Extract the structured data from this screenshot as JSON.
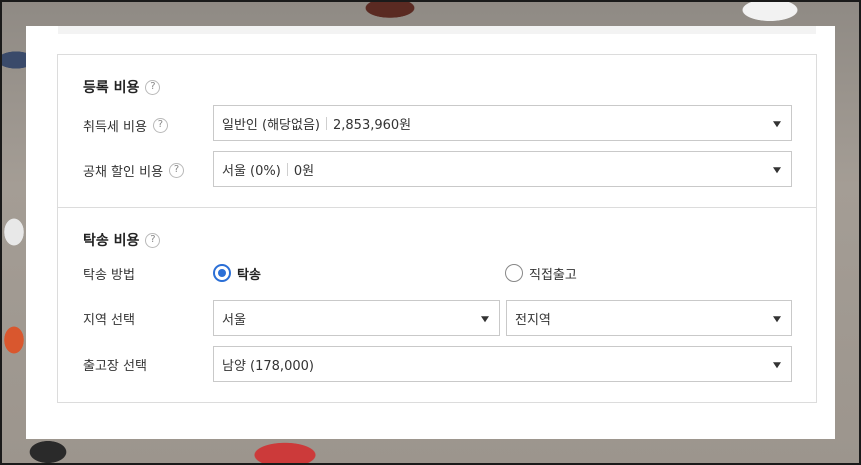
{
  "registration": {
    "title": "등록 비용",
    "help": "?",
    "acquisition_tax": {
      "label": "취득세 비용",
      "help": "?",
      "selected_type": "일반인 (해당없음)",
      "selected_amount": "2,853,960원"
    },
    "bond_discount": {
      "label": "공채 할인 비용",
      "help": "?",
      "selected_region": "서울 (0%)",
      "selected_amount": "0원"
    }
  },
  "delivery": {
    "title": "탁송 비용",
    "help": "?",
    "method": {
      "label": "탁송 방법",
      "options": [
        {
          "label": "탁송",
          "checked": true
        },
        {
          "label": "직접출고",
          "checked": false
        }
      ]
    },
    "region": {
      "label": "지역 선택",
      "selected_city": "서울",
      "selected_district": "전지역"
    },
    "depot": {
      "label": "출고장 선택",
      "selected": "남양 (178,000)"
    }
  },
  "colors": {
    "accent": "#2b6fd6",
    "border": "#c9c9c9"
  }
}
